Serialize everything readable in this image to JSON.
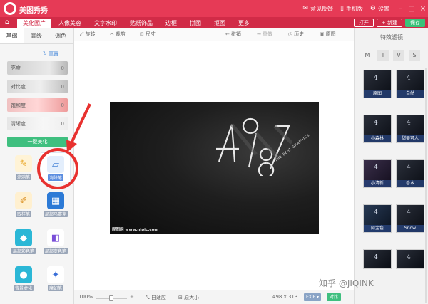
{
  "app": {
    "title": "美图秀秀"
  },
  "top_right": {
    "feedback": "意见反馈",
    "mobile": "手机版",
    "settings": "设置"
  },
  "nav": {
    "tabs": [
      "美化图片",
      "人像美容",
      "文字水印",
      "贴纸饰品",
      "边框",
      "拼图",
      "抠图",
      "更多"
    ],
    "open": "打开",
    "new": "+ 新建",
    "save": "保存"
  },
  "left_panel": {
    "tabs": [
      "基础",
      "高级",
      "调色"
    ],
    "reset": "重置",
    "sliders": [
      {
        "label": "亮度",
        "value": "0"
      },
      {
        "label": "对比度",
        "value": "0"
      },
      {
        "label": "饱和度",
        "value": "0"
      },
      {
        "label": "清晰度",
        "value": "0"
      }
    ],
    "one_key": "一键美化",
    "tools": [
      {
        "label": "涂鸦笔",
        "icon": "brush-icon"
      },
      {
        "label": "消除笔",
        "icon": "eraser-icon"
      },
      {
        "label": "取样笔",
        "icon": "picker-icon"
      },
      {
        "label": "局部马赛克",
        "icon": "mosaic-icon"
      },
      {
        "label": "局部彩色笔",
        "icon": "color-pen-icon"
      },
      {
        "label": "局部变色笔",
        "icon": "swap-color-icon"
      },
      {
        "label": "背景虚化",
        "icon": "blur-icon"
      },
      {
        "label": "魔幻笔",
        "icon": "magic-icon"
      }
    ]
  },
  "toolbar": {
    "rotate": "旋转",
    "crop": "裁剪",
    "size": "尺寸",
    "undo": "撤销",
    "redo": "重做",
    "history": "历史",
    "original": "原图"
  },
  "canvas": {
    "photo_text": "4 9 8 7",
    "photo_tag": "THE BEST GRAPHICS",
    "watermark": "昵图网 www.nipic.com"
  },
  "status": {
    "zoom": "100%",
    "fit": "自适应",
    "actual": "原大小",
    "dims": "498 x 313",
    "exif": "EXIF",
    "compare": "对比",
    "zoom_level": 0.44
  },
  "right_panel": {
    "title": "特效滤镜",
    "categories": [
      "M",
      "T",
      "V",
      "S"
    ],
    "filters": [
      "原图",
      "自然",
      "小森林",
      "甜美可人",
      "小清新",
      "香水",
      "阿宝色",
      "Snow"
    ]
  },
  "overlay": {
    "zhihu_watermark": "知乎 @JIQINK"
  },
  "colors": {
    "brand": "#e63a56",
    "nav": "#d12b47",
    "accent_green": "#3fbf7f",
    "annotation_red": "#e8312f"
  }
}
